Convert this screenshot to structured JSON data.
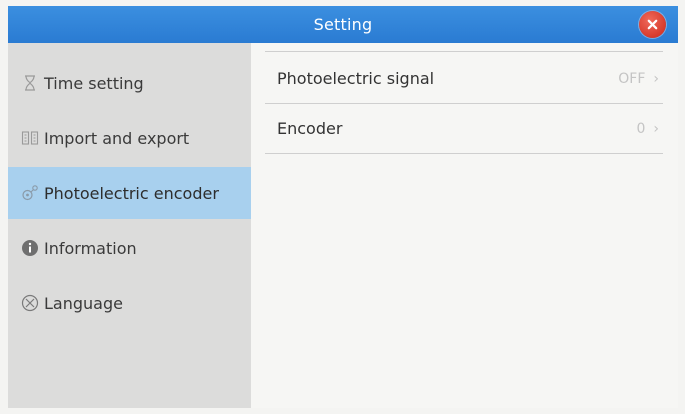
{
  "window": {
    "title": "Setting",
    "close_icon": "close-x-icon",
    "accent": "#2f83d8",
    "close_color": "#dd4536"
  },
  "sidebar": {
    "items": [
      {
        "label": "Time setting",
        "icon": "hourglass-icon",
        "active": false
      },
      {
        "label": "Import and export",
        "icon": "import-export-icon",
        "active": false
      },
      {
        "label": "Photoelectric encoder",
        "icon": "encoder-icon",
        "active": true
      },
      {
        "label": "Information",
        "icon": "info-icon",
        "active": false
      },
      {
        "label": "Language",
        "icon": "globe-icon",
        "active": false
      }
    ],
    "active_color": "#a8d0ee"
  },
  "content": {
    "rows": [
      {
        "label": "Photoelectric signal",
        "value": "OFF",
        "icon": "chevron-right-icon"
      },
      {
        "label": "Encoder",
        "value": "0",
        "icon": "chevron-right-icon"
      }
    ]
  }
}
